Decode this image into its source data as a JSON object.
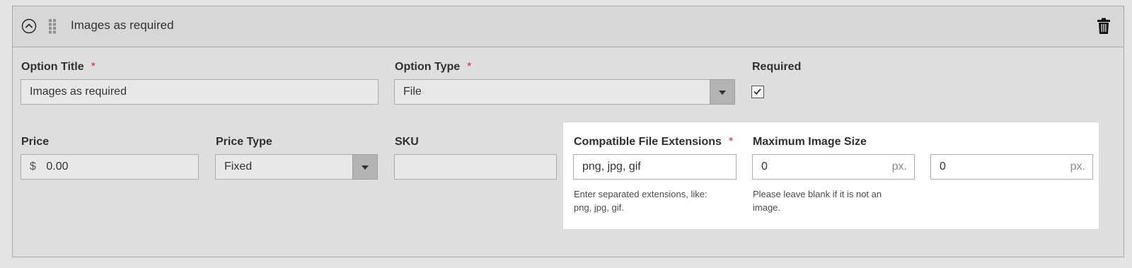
{
  "header": {
    "title": "Images as required",
    "collapse_icon": "chevron-up-circle-icon",
    "drag_icon": "drag-handle-icon",
    "delete_icon": "trash-icon"
  },
  "fields": {
    "option_title": {
      "label": "Option Title",
      "required": "*",
      "value": "Images as required"
    },
    "option_type": {
      "label": "Option Type",
      "required": "*",
      "value": "File"
    },
    "required": {
      "label": "Required",
      "checked": true
    },
    "price": {
      "label": "Price",
      "currency": "$",
      "value": "0.00"
    },
    "price_type": {
      "label": "Price Type",
      "value": "Fixed"
    },
    "sku": {
      "label": "SKU",
      "value": ""
    },
    "file_extensions": {
      "label": "Compatible File Extensions",
      "required": "*",
      "value": "png, jpg, gif",
      "note_line1": "Enter separated extensions, like:",
      "note_line2": "png, jpg, gif."
    },
    "max_image_size": {
      "label": "Maximum Image Size",
      "width_value": "0",
      "height_value": "0",
      "unit": "px.",
      "note_line1": "Please leave blank if it is not an",
      "note_line2": "image."
    }
  },
  "colors": {
    "required_star": "#e22626",
    "panel_bg": "#dedede",
    "header_bg": "#d7d7d7"
  }
}
